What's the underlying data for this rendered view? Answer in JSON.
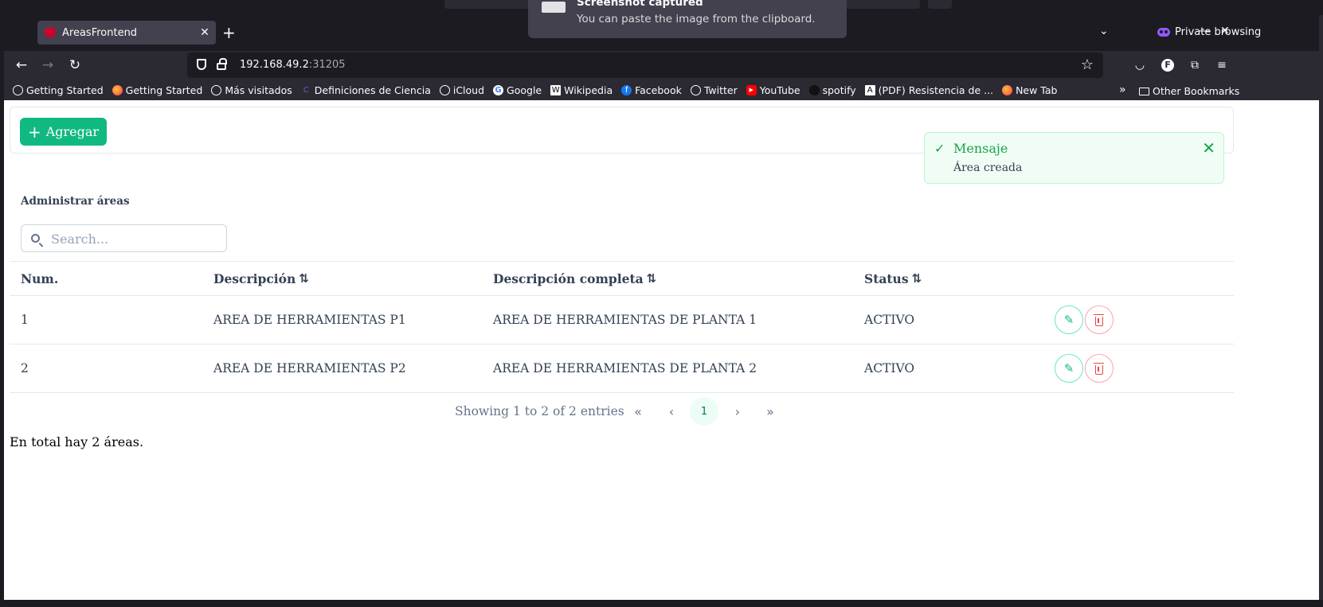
{
  "browser": {
    "tab_title": "AreasFrontend",
    "tab_close": "✕",
    "new_tab": "+",
    "private_label": "Private browsing",
    "minimize": "—",
    "close_window": "✕",
    "url_host": "192.168.49.2",
    "url_port": ":31205",
    "back": "←",
    "forward": "→",
    "reload": "↻",
    "star": "☆"
  },
  "bookmarks": [
    {
      "label": "Getting Started",
      "icon": "globe-icon",
      "color": "#fbfbfe"
    },
    {
      "label": "Getting Started",
      "icon": "firefox-icon",
      "color": "#ff7139"
    },
    {
      "label": "Más visitados",
      "icon": "gear-icon",
      "color": "#fbfbfe"
    },
    {
      "label": "Definiciones de Ciencia",
      "icon": "c-icon",
      "color": "#2f2a6b"
    },
    {
      "label": "iCloud",
      "icon": "globe-icon",
      "color": "#fbfbfe"
    },
    {
      "label": "Google",
      "icon": "google-icon",
      "color": "#ffffff"
    },
    {
      "label": "Wikipedia",
      "icon": "wikipedia-icon",
      "color": "#ffffff"
    },
    {
      "label": "Facebook",
      "icon": "facebook-icon",
      "color": "#1877f2"
    },
    {
      "label": "Twitter",
      "icon": "globe-icon",
      "color": "#fbfbfe"
    },
    {
      "label": "YouTube",
      "icon": "youtube-icon",
      "color": "#ff0000"
    },
    {
      "label": "spotify",
      "icon": "spotify-icon",
      "color": "#111111"
    },
    {
      "label": "(PDF) Resistencia de ...",
      "icon": "academia-icon",
      "color": "#ffffff"
    },
    {
      "label": "New Tab",
      "icon": "firefox-icon",
      "color": "#ff7139"
    }
  ],
  "bookmarks_other": "Other Bookmarks",
  "notification": {
    "title": "Screenshot captured",
    "body": "You can paste the image from the clipboard."
  },
  "toolbar": {
    "add_label": "Agregar"
  },
  "toast": {
    "title": "Mensaje",
    "detail": "Área creada"
  },
  "section_title": "Administrar áreas",
  "search": {
    "placeholder": "Search..."
  },
  "table": {
    "headers": {
      "num": "Num.",
      "descripcion": "Descripción",
      "descripcion_completa": "Descripción completa",
      "status": "Status"
    },
    "rows": [
      {
        "num": "1",
        "descripcion": "AREA DE HERRAMIENTAS P1",
        "descripcion_completa": "AREA DE HERRAMIENTAS DE PLANTA 1",
        "status": "ACTIVO"
      },
      {
        "num": "2",
        "descripcion": "AREA DE HERRAMIENTAS P2",
        "descripcion_completa": "AREA DE HERRAMIENTAS DE PLANTA 2",
        "status": "ACTIVO"
      }
    ]
  },
  "paginator": {
    "summary": "Showing 1 to 2 of 2 entries",
    "first": "«",
    "prev": "‹",
    "current_page": "1",
    "next": "›",
    "last": "»"
  },
  "total_text": "En total hay 2 áreas.",
  "colors": {
    "primary": "#10b981",
    "danger": "#ef4444",
    "toast_bg": "#f0fdf4",
    "browser_bg": "#2b2a33"
  }
}
